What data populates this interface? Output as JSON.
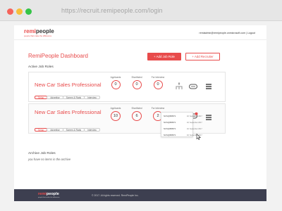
{
  "browser": {
    "url": "https://recruit.remipeople.com/login"
  },
  "header": {
    "logo_prefix": "remi",
    "logo_suffix": "people",
    "logo_tagline": "people that make the difference",
    "user_links": "remiadmin@remipeople.onmicrosoft.com | Logout"
  },
  "dashboard": {
    "title": "RemiPeople Dashboard",
    "add_job_label": "+ Add Job Role",
    "add_recruiter_label": "+ Add Recruiter",
    "active_label": "Active Job Roles",
    "jobs": [
      {
        "title": "New Car Sales Professional",
        "applicants_label": "Applicants",
        "applicants": "0",
        "shortlisted_label": "Shortlisted",
        "shortlisted": "0",
        "interview_label": "For Interview",
        "interview": "0",
        "pipeline": [
          "Setup",
          "Advertise",
          "Screen & Rank",
          "Interview"
        ]
      },
      {
        "title": "New Car Sales Professional",
        "applicants_label": "Applicants",
        "applicants": "10",
        "shortlisted_label": "Shortlisted",
        "shortlisted": "6",
        "interview_label": "For Interview",
        "interview": "2",
        "pipeline": [
          "Setup",
          "Advertise",
          "Screen & Rank",
          "Interview"
        ]
      }
    ],
    "dropdown": [
      {
        "code": "NCSQ958671",
        "date": "18, September 2017"
      },
      {
        "code": "NCSQ958671",
        "date": "18, September 2017"
      },
      {
        "code": "NCSQ958671",
        "date": "18, September 2017"
      },
      {
        "code": "NCSQ958671",
        "date": "18, September 2017"
      }
    ],
    "archive_label": "Archive Job Roles",
    "archive_empty": "you have no items in the archive"
  },
  "footer": {
    "logo_prefix": "remi",
    "logo_suffix": "people",
    "tagline": "people that make the difference",
    "copyright": "© 2017. All rights reserved. RemiPeople Inc."
  },
  "colors": {
    "accent": "#e84b4b",
    "footer": "#3d3f50",
    "chrome": "#e6e6e6"
  },
  "icons": [
    "hierarchy-icon",
    "chat-icon",
    "menu-icon",
    "cursor-icon"
  ]
}
